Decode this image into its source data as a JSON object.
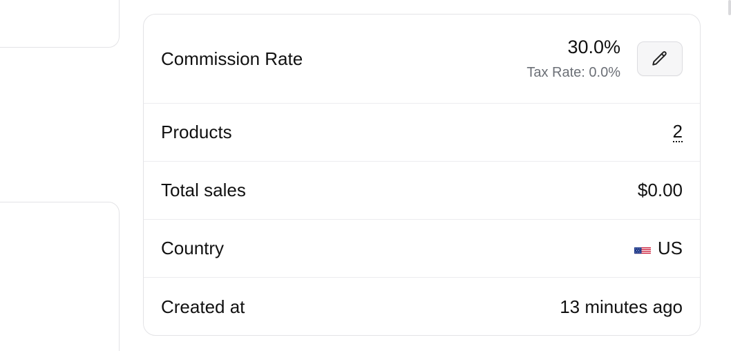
{
  "details": {
    "commission_label": "Commission Rate",
    "commission_value": "30.0%",
    "tax_rate": "Tax Rate: 0.0%",
    "products_label": "Products",
    "products_value": "2",
    "sales_label": "Total sales",
    "sales_value": "$0.00",
    "country_label": "Country",
    "country_value": "US",
    "created_label": "Created at",
    "created_value": "13 minutes ago"
  },
  "icons": {
    "edit": "pencil-icon",
    "flag": "us-flag-icon"
  }
}
